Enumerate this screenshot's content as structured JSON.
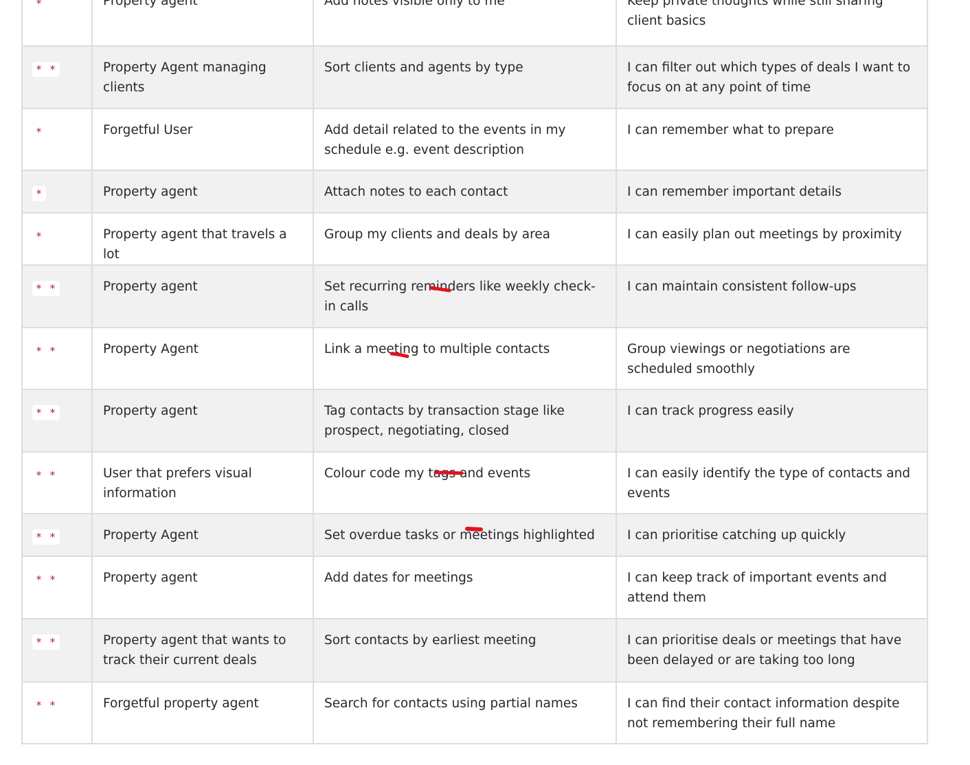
{
  "table": {
    "rows": [
      {
        "priority": "*",
        "role": "Property agent",
        "want": "Add notes visible only to me",
        "benefit": "Keep private thoughts while still sharing client basics"
      },
      {
        "priority": "* *",
        "role": "Property Agent managing clients",
        "want": "Sort clients and agents by type",
        "benefit": "I can filter out which types of deals I want to focus on at any point of time"
      },
      {
        "priority": "*",
        "role": "Forgetful User",
        "want": "Add detail related to the events in my schedule e.g. event description",
        "benefit": "I can remember what to prepare"
      },
      {
        "priority": "*",
        "role": "Property agent",
        "want": "Attach notes to each contact",
        "benefit": "I can remember important details"
      },
      {
        "priority": "*",
        "role": "Property agent that travels a lot",
        "want": "Group my clients and deals by area",
        "benefit": "I can easily plan out meetings by proximity"
      },
      {
        "priority": "* *",
        "role": "Property agent",
        "want": "Set recurring reminders like weekly check-in calls",
        "benefit": "I can maintain consistent follow-ups"
      },
      {
        "priority": "* *",
        "role": "Property Agent",
        "want": "Link a meeting to multiple contacts",
        "benefit": "Group viewings or negotiations are scheduled smoothly"
      },
      {
        "priority": "* *",
        "role": "Property agent",
        "want": "Tag contacts by transaction stage like prospect, negotiating, closed",
        "benefit": "I can track progress easily"
      },
      {
        "priority": "* *",
        "role": "User that prefers visual information",
        "want": "Colour code my tags and events",
        "benefit": "I can easily identify the type of contacts and events"
      },
      {
        "priority": "* *",
        "role": "Property Agent",
        "want": "Set overdue tasks or meetings highlighted",
        "benefit": "I can prioritise catching up quickly"
      },
      {
        "priority": "* *",
        "role": "Property agent",
        "want": "Add dates for meetings",
        "benefit": "I can keep track of important events and attend them"
      },
      {
        "priority": "* *",
        "role": "Property agent that wants to track their current deals",
        "want": "Sort contacts by earliest meeting",
        "benefit": "I can prioritise deals or meetings that have been delayed or are taking too long"
      },
      {
        "priority": "* *",
        "role": "Forgetful property agent",
        "want": "Search for contacts using partial names",
        "benefit": "I can find their contact information despite not remembering their full name"
      }
    ]
  },
  "colors": {
    "priority_text": "#b31d28",
    "annotation_marks": "#e0141e",
    "row_alt_background": "#f1f1f1",
    "border": "#d8dee4"
  }
}
